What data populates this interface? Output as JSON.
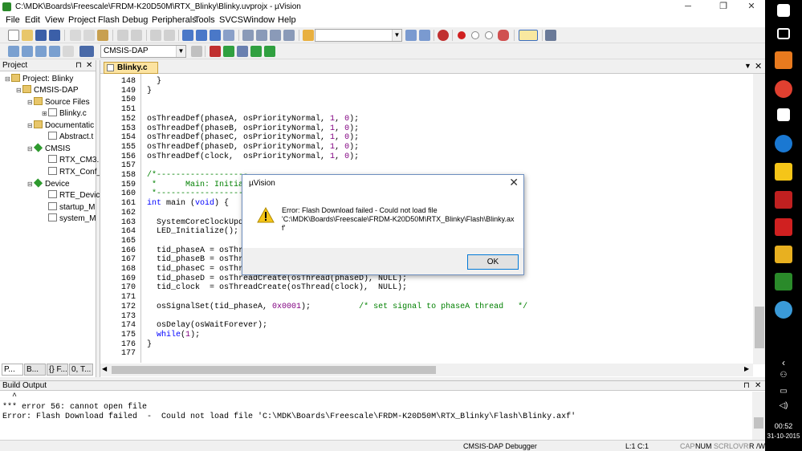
{
  "window": {
    "title": "C:\\MDK\\Boards\\Freescale\\FRDM-K20D50M\\RTX_Blinky\\Blinky.uvprojx - µVision"
  },
  "menu": [
    "File",
    "Edit",
    "View",
    "Project",
    "Flash",
    "Debug",
    "Peripherals",
    "Tools",
    "SVCS",
    "Window",
    "Help"
  ],
  "toolbar2": {
    "target_combo": "CMSIS-DAP"
  },
  "project_panel": {
    "title": "Project",
    "tree": [
      {
        "label": "Project: Blinky"
      },
      {
        "label": "CMSIS-DAP"
      },
      {
        "label": "Source Files"
      },
      {
        "label": "Blinky.c"
      },
      {
        "label": "Documentatic"
      },
      {
        "label": "Abstract.t"
      },
      {
        "label": "CMSIS"
      },
      {
        "label": "RTX_CM3."
      },
      {
        "label": "RTX_Conf_"
      },
      {
        "label": "Device"
      },
      {
        "label": "RTE_Devic"
      },
      {
        "label": "startup_M"
      },
      {
        "label": "system_M"
      }
    ],
    "tabs": [
      "P...",
      "B...",
      "{} F...",
      "0, T..."
    ]
  },
  "editor": {
    "tab": "Blinky.c",
    "lines": [
      {
        "n": "148",
        "t": "  }"
      },
      {
        "n": "149",
        "t": "}"
      },
      {
        "n": "150",
        "t": ""
      },
      {
        "n": "151",
        "t": ""
      },
      {
        "n": "152",
        "t": "osThreadDef(phaseA, osPriorityNormal, 1, 0);"
      },
      {
        "n": "153",
        "t": "osThreadDef(phaseB, osPriorityNormal, 1, 0);"
      },
      {
        "n": "154",
        "t": "osThreadDef(phaseC, osPriorityNormal, 1, 0);"
      },
      {
        "n": "155",
        "t": "osThreadDef(phaseD, osPriorityNormal, 1, 0);"
      },
      {
        "n": "156",
        "t": "osThreadDef(clock,  osPriorityNormal, 1, 0);"
      },
      {
        "n": "157",
        "t": ""
      },
      {
        "n": "158",
        "t": "/*-------------------"
      },
      {
        "n": "159",
        "t": " *      Main: Initia"
      },
      {
        "n": "160",
        "t": " *-------------------"
      },
      {
        "n": "161",
        "t": "int main (void) {"
      },
      {
        "n": "162",
        "t": ""
      },
      {
        "n": "163",
        "t": "  SystemCoreClockUpda"
      },
      {
        "n": "164",
        "t": "  LED_Initialize();"
      },
      {
        "n": "165",
        "t": ""
      },
      {
        "n": "166",
        "t": "  tid_phaseA = osThre"
      },
      {
        "n": "167",
        "t": "  tid_phaseB = osThre"
      },
      {
        "n": "168",
        "t": "  tid_phaseC = osThre"
      },
      {
        "n": "169",
        "t": "  tid_phaseD = osThreadCreate(osThread(phaseD), NULL);"
      },
      {
        "n": "170",
        "t": "  tid_clock  = osThreadCreate(osThread(clock),  NULL);"
      },
      {
        "n": "171",
        "t": ""
      },
      {
        "n": "172",
        "t": "  osSignalSet(tid_phaseA, 0x0001);          /* set signal to phaseA thread   */"
      },
      {
        "n": "173",
        "t": ""
      },
      {
        "n": "174",
        "t": "  osDelay(osWaitForever);"
      },
      {
        "n": "175",
        "t": "  while(1);"
      },
      {
        "n": "176",
        "t": "}"
      },
      {
        "n": "177",
        "t": ""
      }
    ]
  },
  "build_output": {
    "title": "Build Output",
    "lines": [
      "  ^",
      "*** error 56: cannot open file",
      "Error: Flash Download failed  -  Could not load file 'C:\\MDK\\Boards\\Freescale\\FRDM-K20D50M\\RTX_Blinky\\Flash\\Blinky.axf'"
    ]
  },
  "status_bar": {
    "debugger": "CMSIS-DAP Debugger",
    "position": "L:1 C:1",
    "caps": "CAP",
    "num": "NUM",
    "scrl": "SCRL",
    "ovr": "OVR",
    "rw": "R /W"
  },
  "dialog": {
    "title": "µVision",
    "message_line1": "Error: Flash Download failed  -  Could not load file",
    "message_line2": "'C:\\MDK\\Boards\\Freescale\\FRDM-K20D50M\\RTX_Blinky\\Flash\\Blinky.ax",
    "message_line3": "f'",
    "ok_label": "OK"
  },
  "taskbar": {
    "time": "00:52",
    "date": "31-10-2015"
  }
}
